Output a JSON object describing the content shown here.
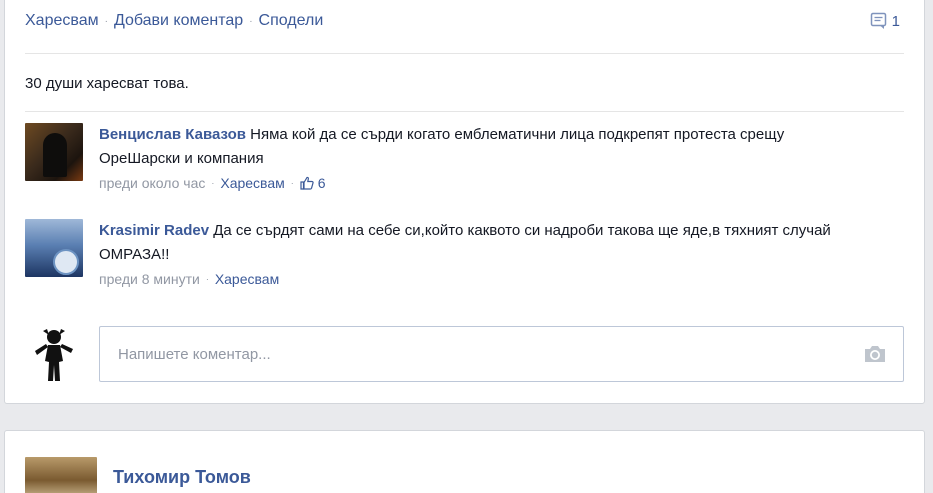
{
  "post_actions": {
    "like": "Харесвам",
    "comment": "Добави коментар",
    "share": "Сподели",
    "comment_count": "1"
  },
  "likes_summary": "30 души харесват това.",
  "comments": [
    {
      "author": "Венцислав Кавазов",
      "text": "Няма кой да се сърди когато емблематични лица подкрепят протеста срещу ОреШарски и компания",
      "time": "преди около час",
      "like_label": "Харесвам",
      "like_count": "6"
    },
    {
      "author": "Krasimir Radev",
      "text": "Да се сърдят сами на себе си,който каквото си надроби такова ще яде,в тяхният случай ОМРАЗА!!",
      "time": "преди 8 минути",
      "like_label": "Харесвам"
    }
  ],
  "composer": {
    "placeholder": "Напишете коментар..."
  },
  "next_post": {
    "author": "Тихомир Томов"
  },
  "colors": {
    "link": "#3b5998",
    "meta": "#9197a3",
    "background": "#e9eaed"
  },
  "icons": [
    "comment-bubble-icon",
    "thumbs-up-icon",
    "camera-icon"
  ]
}
